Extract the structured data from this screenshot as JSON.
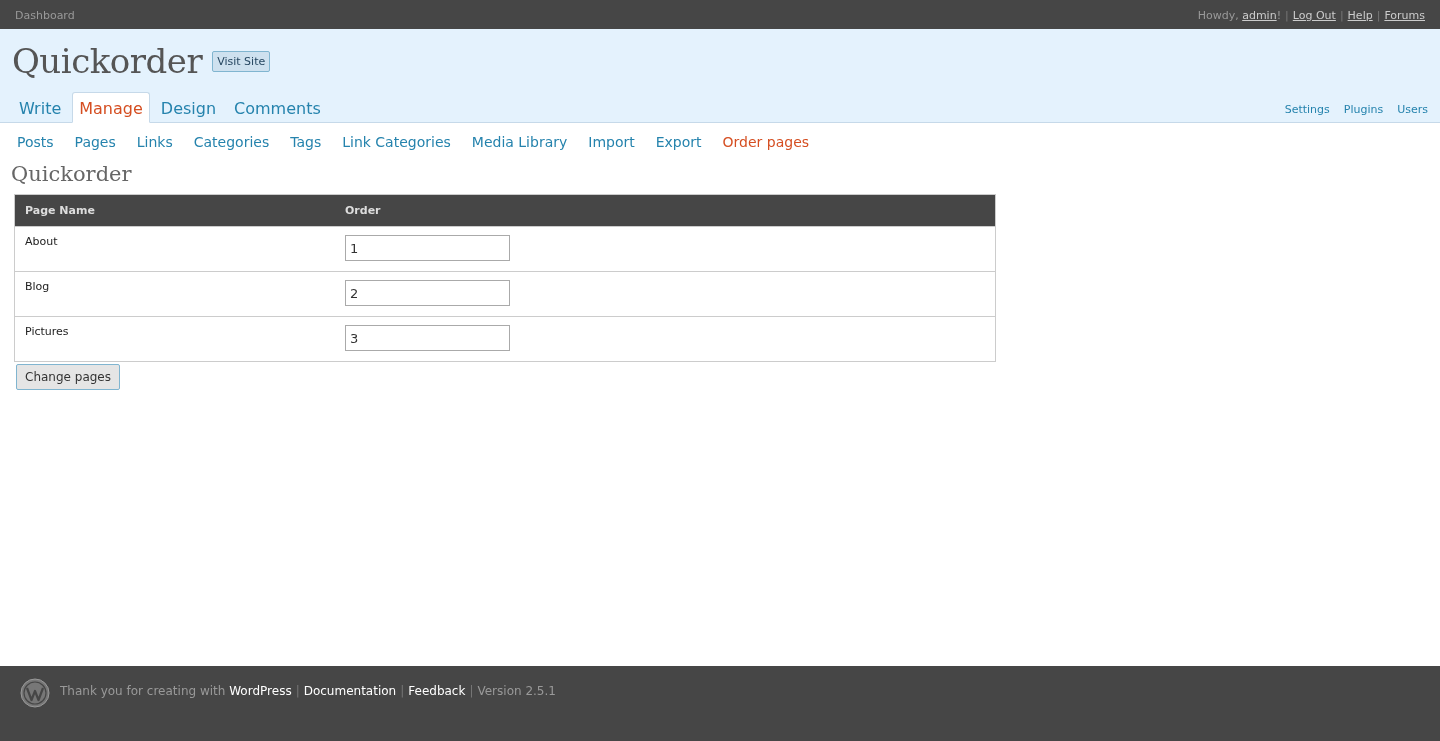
{
  "top_bar": {
    "dashboard": "Dashboard",
    "greeting": "Howdy, ",
    "user": "admin",
    "greeting_end": "!",
    "separator": "|",
    "links": [
      "Log Out",
      "Help",
      "Forums"
    ]
  },
  "header": {
    "site_title": "Quickorder",
    "visit_button": "Visit Site"
  },
  "main_tabs": [
    {
      "label": "Write",
      "selected": false
    },
    {
      "label": "Manage",
      "selected": true
    },
    {
      "label": "Design",
      "selected": false
    },
    {
      "label": "Comments",
      "selected": false
    }
  ],
  "side_links": [
    "Settings",
    "Plugins",
    "Users"
  ],
  "sub_nav": [
    {
      "label": "Posts",
      "selected": false
    },
    {
      "label": "Pages",
      "selected": false
    },
    {
      "label": "Links",
      "selected": false
    },
    {
      "label": "Categories",
      "selected": false
    },
    {
      "label": "Tags",
      "selected": false
    },
    {
      "label": "Link Categories",
      "selected": false
    },
    {
      "label": "Media Library",
      "selected": false
    },
    {
      "label": "Import",
      "selected": false
    },
    {
      "label": "Export",
      "selected": false
    },
    {
      "label": "Order pages",
      "selected": true
    }
  ],
  "page_title": "Quickorder",
  "table": {
    "columns": [
      "Page Name",
      "Order"
    ],
    "rows": [
      {
        "name": "About",
        "order": "1"
      },
      {
        "name": "Blog",
        "order": "2"
      },
      {
        "name": "Pictures",
        "order": "3"
      }
    ]
  },
  "submit_button": "Change pages",
  "footer": {
    "thanks": "Thank you for creating with",
    "separator": "|",
    "links": [
      "WordPress",
      "Documentation",
      "Feedback"
    ],
    "version": "Version 2.5.1"
  }
}
